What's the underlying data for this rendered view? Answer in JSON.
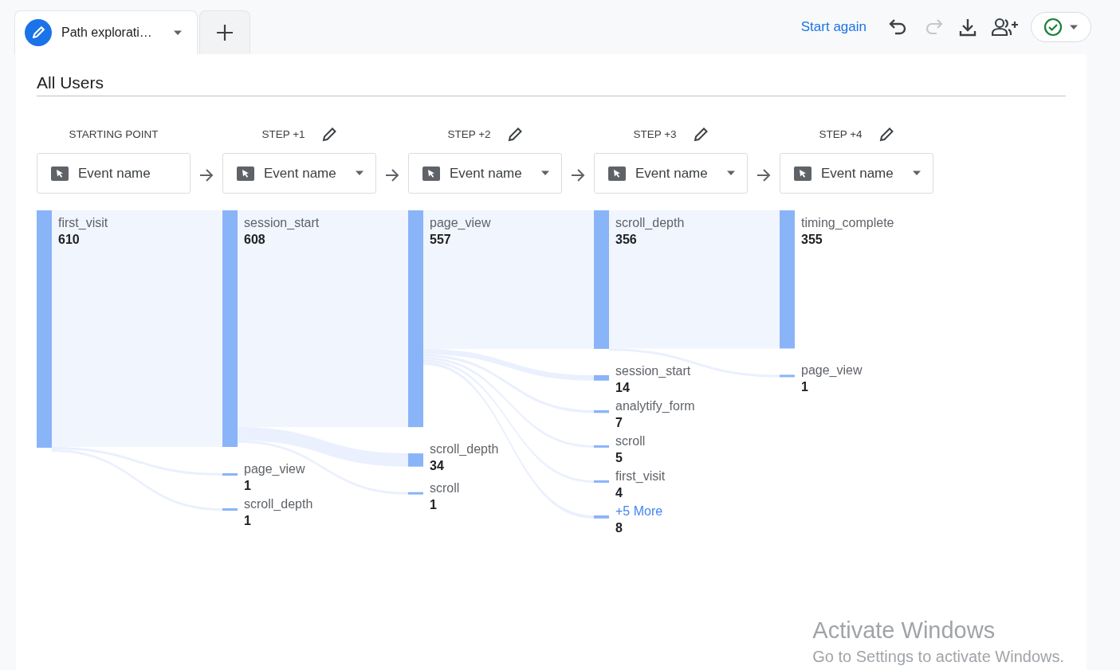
{
  "tabs": [
    {
      "label": "Path explorati…",
      "selected": true
    }
  ],
  "toolbar": {
    "start_again": "Start again",
    "redo_disabled": true
  },
  "segment_title": "All Users",
  "steps": [
    {
      "header": "STARTING POINT",
      "editable": false,
      "field": "Event name",
      "dropdown": false,
      "nodes": [
        {
          "kind": "event",
          "name": "first_visit",
          "count": "610"
        }
      ]
    },
    {
      "header": "STEP +1",
      "editable": true,
      "field": "Event name",
      "dropdown": true,
      "nodes": [
        {
          "kind": "event",
          "name": "session_start",
          "count": "608"
        },
        {
          "kind": "event",
          "name": "page_view",
          "count": "1"
        },
        {
          "kind": "event",
          "name": "scroll_depth",
          "count": "1"
        }
      ]
    },
    {
      "header": "STEP +2",
      "editable": true,
      "field": "Event name",
      "dropdown": true,
      "nodes": [
        {
          "kind": "event",
          "name": "page_view",
          "count": "557"
        },
        {
          "kind": "event",
          "name": "scroll_depth",
          "count": "34"
        },
        {
          "kind": "event",
          "name": "scroll",
          "count": "1"
        }
      ]
    },
    {
      "header": "STEP +3",
      "editable": true,
      "field": "Event name",
      "dropdown": true,
      "nodes": [
        {
          "kind": "event",
          "name": "scroll_depth",
          "count": "356"
        },
        {
          "kind": "event",
          "name": "session_start",
          "count": "14"
        },
        {
          "kind": "event",
          "name": "analytify_form",
          "count": "7"
        },
        {
          "kind": "event",
          "name": "scroll",
          "count": "5"
        },
        {
          "kind": "event",
          "name": "first_visit",
          "count": "4"
        },
        {
          "kind": "more",
          "name": "+5 More",
          "count": "8"
        }
      ]
    },
    {
      "header": "STEP +4",
      "editable": true,
      "field": "Event name",
      "dropdown": true,
      "nodes": [
        {
          "kind": "event",
          "name": "timing_complete",
          "count": "355"
        },
        {
          "kind": "event",
          "name": "page_view",
          "count": "1"
        }
      ]
    }
  ],
  "os_overlay": {
    "title": "Activate Windows",
    "subtitle": "Go to Settings to activate Windows."
  }
}
